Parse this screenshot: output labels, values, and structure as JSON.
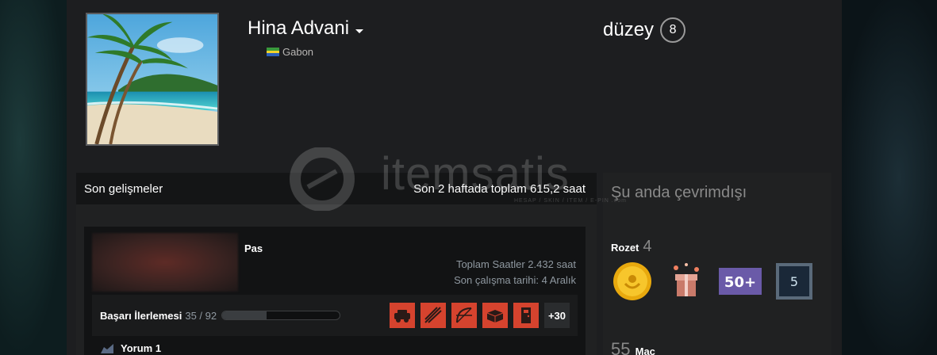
{
  "profile": {
    "persona_name": "Hina Advani",
    "location": "Gabon",
    "level_label": "düzey",
    "level_value": "8"
  },
  "watermark": {
    "text": "itemsatis",
    "subtitle": "HESAP / SKIN / ITEM / E-PIN .com"
  },
  "activity": {
    "title": "Son gelişmeler",
    "hours_summary": "Son 2 haftada toplam 615,2 saat",
    "game": {
      "name": "Pas",
      "total_hours": "Toplam Saatler 2.432 saat",
      "last_played": "Son çalışma tarihi: 4 Aralık",
      "achievement_label": "Başarı İlerlemesi",
      "achievement_count": "35 / 92",
      "achievement_progress": 0.38,
      "achievement_icons": [
        "car-icon",
        "arrows-icon",
        "bow-icon",
        "crate-icon",
        "locker-icon"
      ],
      "more_achievements": "+30"
    },
    "comment_label": "Yorum 1"
  },
  "sidebar": {
    "status": "Şu anda çevrimdışı",
    "badges_label": "Rozet",
    "badges_count": "4",
    "badges": [
      {
        "name": "gold-coin-badge"
      },
      {
        "name": "gift-box-badge"
      },
      {
        "name": "fifty-plus-badge",
        "text": "50+"
      },
      {
        "name": "years-badge",
        "text": "5"
      }
    ],
    "games_count": "55",
    "games_label": "Maç"
  },
  "colors": {
    "achievement_red": "#d5432e",
    "flag_green": "#3a9a3a",
    "flag_yellow": "#f2d22a",
    "flag_blue": "#2b5fb8"
  }
}
